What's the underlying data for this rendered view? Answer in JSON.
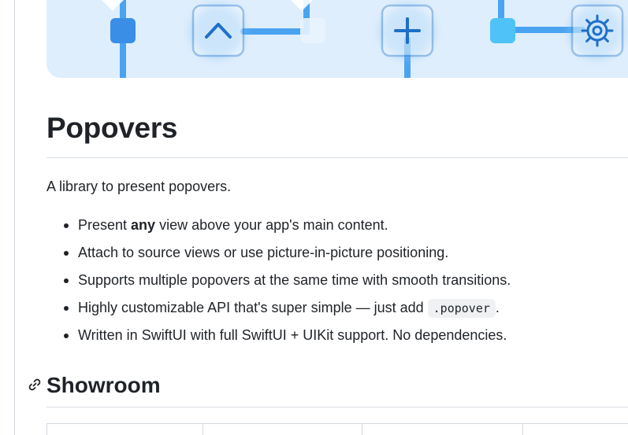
{
  "heading": "Popovers",
  "intro": "A library to present popovers.",
  "features": [
    {
      "prefix": "Present ",
      "bold": "any",
      "suffix": " view above your app's main content.",
      "code": "",
      "tail": ""
    },
    {
      "prefix": "Attach to source views or use picture-in-picture positioning.",
      "bold": "",
      "suffix": "",
      "code": "",
      "tail": ""
    },
    {
      "prefix": "Supports multiple popovers at the same time with smooth transitions.",
      "bold": "",
      "suffix": "",
      "code": "",
      "tail": ""
    },
    {
      "prefix": "Highly customizable API that's super simple — just add ",
      "bold": "",
      "suffix": "",
      "code": ".popover",
      "tail": "."
    },
    {
      "prefix": "Written in SwiftUI with full SwiftUI + UIKit support. No dependencies.",
      "bold": "",
      "suffix": "",
      "code": "",
      "tail": ""
    }
  ],
  "section": {
    "title": "Showroom",
    "anchor_icon": "link-icon"
  },
  "banner": {
    "icons": [
      "chevron-up-icon",
      "plus-icon",
      "gear-icon"
    ],
    "accent": "#1e88e5",
    "background": "#dfeefc"
  }
}
